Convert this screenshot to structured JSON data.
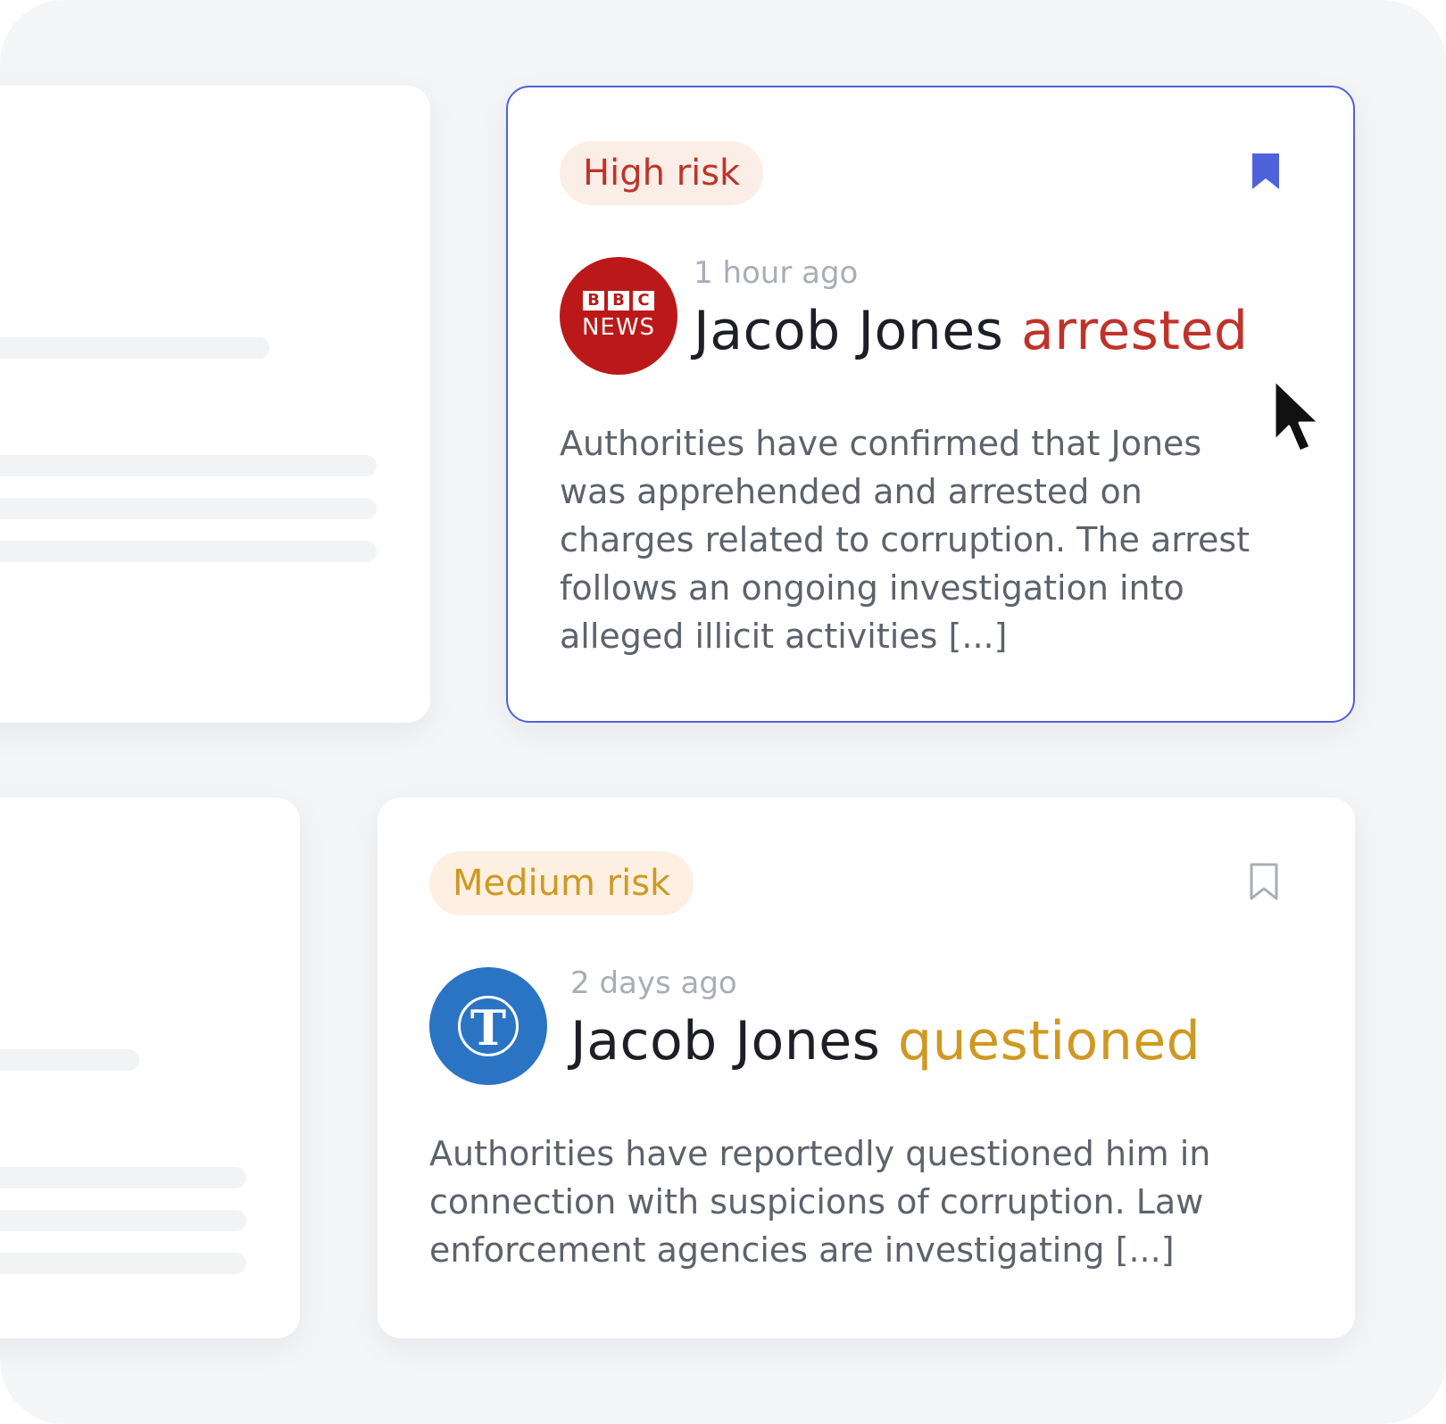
{
  "colors": {
    "high_risk": "#c0332a",
    "medium_risk": "#cf9921",
    "accent": "#4f62db",
    "bbc_red": "#bb1919",
    "telegraph_blue": "#2b74c4"
  },
  "cards": [
    {
      "badge": "High risk",
      "bookmark": "bookmark-filled-icon",
      "source_logo": {
        "line1": "BBC",
        "line2": "NEWS"
      },
      "time": "1 hour ago",
      "headline_name": "Jacob Jones",
      "headline_verb": "arrested",
      "excerpt": "Authorities have confirmed that Jones was apprehended and arrested on charges related to corruption. The arrest follows an ongoing investigation into alleged illicit activities [...]"
    },
    {
      "badge": "Medium risk",
      "bookmark": "bookmark-outline-icon",
      "source_logo": {
        "glyph": "T"
      },
      "time": "2 days ago",
      "headline_name": "Jacob Jones",
      "headline_verb": "questioned",
      "excerpt": "Authorities have reportedly questioned him in connection with suspicions of corruption. Law enforcement agencies are investigating [...]"
    }
  ]
}
